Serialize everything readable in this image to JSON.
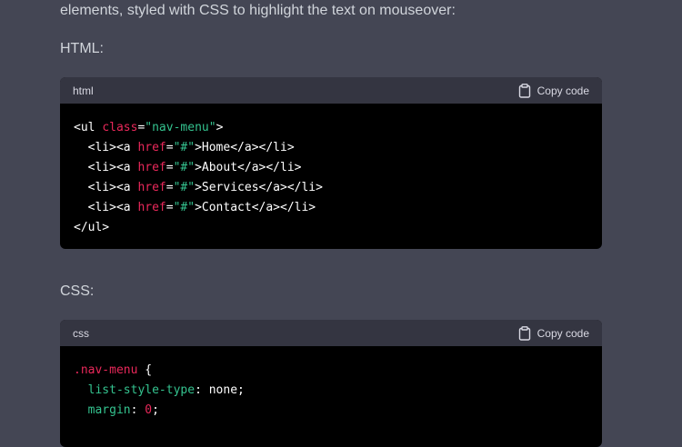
{
  "intro_text": "elements, styled with CSS to highlight the text on mouseover:",
  "html_label": "HTML:",
  "css_label": "CSS:",
  "html_block": {
    "language": "html",
    "copy_label": "Copy code",
    "lines": [
      [
        {
          "t": "tag",
          "v": "<ul "
        },
        {
          "t": "attr",
          "v": "class"
        },
        {
          "t": "tag",
          "v": "="
        },
        {
          "t": "str",
          "v": "\"nav-menu\""
        },
        {
          "t": "tag",
          "v": ">"
        }
      ],
      [
        {
          "t": "tag",
          "v": "  <li><a "
        },
        {
          "t": "attr",
          "v": "href"
        },
        {
          "t": "tag",
          "v": "="
        },
        {
          "t": "str",
          "v": "\"#\""
        },
        {
          "t": "tag",
          "v": ">Home</a></li>"
        }
      ],
      [
        {
          "t": "tag",
          "v": "  <li><a "
        },
        {
          "t": "attr",
          "v": "href"
        },
        {
          "t": "tag",
          "v": "="
        },
        {
          "t": "str",
          "v": "\"#\""
        },
        {
          "t": "tag",
          "v": ">About</a></li>"
        }
      ],
      [
        {
          "t": "tag",
          "v": "  <li><a "
        },
        {
          "t": "attr",
          "v": "href"
        },
        {
          "t": "tag",
          "v": "="
        },
        {
          "t": "str",
          "v": "\"#\""
        },
        {
          "t": "tag",
          "v": ">Services</a></li>"
        }
      ],
      [
        {
          "t": "tag",
          "v": "  <li><a "
        },
        {
          "t": "attr",
          "v": "href"
        },
        {
          "t": "tag",
          "v": "="
        },
        {
          "t": "str",
          "v": "\"#\""
        },
        {
          "t": "tag",
          "v": ">Contact</a></li>"
        }
      ],
      [
        {
          "t": "tag",
          "v": "</ul>"
        }
      ]
    ]
  },
  "css_block": {
    "language": "css",
    "copy_label": "Copy code",
    "lines": [
      [
        {
          "t": "sel",
          "v": ".nav-menu"
        },
        {
          "t": "tag",
          "v": " {"
        }
      ],
      [
        {
          "t": "prop",
          "v": "  list-style-type"
        },
        {
          "t": "tag",
          "v": ": none;"
        }
      ],
      [
        {
          "t": "prop",
          "v": "  margin"
        },
        {
          "t": "tag",
          "v": ": "
        },
        {
          "t": "attr",
          "v": "0"
        },
        {
          "t": "tag",
          "v": ";"
        }
      ]
    ]
  },
  "colors": {
    "background": "#444654",
    "code_bg": "#000000",
    "header_bg": "#343541",
    "attr": "#e9285a",
    "string": "#34c38f"
  },
  "icons": {
    "copy": "clipboard-icon"
  }
}
